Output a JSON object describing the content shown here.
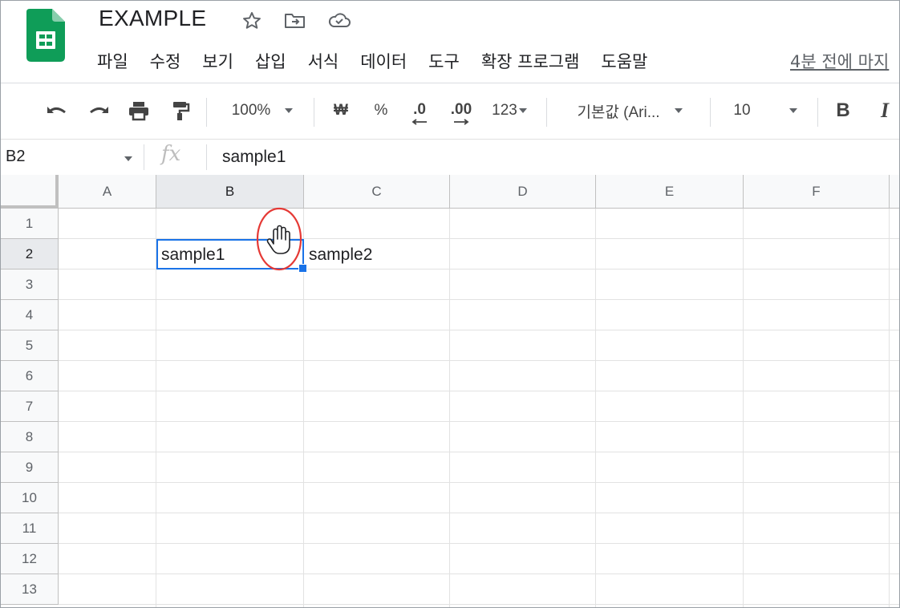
{
  "doc": {
    "title": "EXAMPLE",
    "icons": [
      "star-icon",
      "move-to-folder-icon",
      "cloud-saved-icon"
    ]
  },
  "menu": [
    "파일",
    "수정",
    "보기",
    "삽입",
    "서식",
    "데이터",
    "도구",
    "확장 프로그램",
    "도움말"
  ],
  "last_edit": "4분 전에 마지",
  "toolbar": {
    "zoom": "100%",
    "currency": "₩",
    "percent": "%",
    "dec_decrease": ".0",
    "dec_increase": ".00",
    "format_more": "123",
    "font": "기본값 (Ari...",
    "font_size": "10",
    "bold": "B",
    "italic": "I"
  },
  "formula_bar": {
    "name_box": "B2",
    "fx": "fx",
    "value": "sample1"
  },
  "columns": [
    "A",
    "B",
    "C",
    "D",
    "E",
    "F"
  ],
  "rows": [
    "1",
    "2",
    "3",
    "4",
    "5",
    "6",
    "7",
    "8",
    "9",
    "10",
    "11",
    "12",
    "13"
  ],
  "cells": {
    "B2": "sample1",
    "C2": "sample2"
  },
  "selected_cell": "B2",
  "colors": {
    "sheets_green": "#0f9d58",
    "selection_blue": "#1a73e8",
    "annotation_red": "#e53935"
  }
}
